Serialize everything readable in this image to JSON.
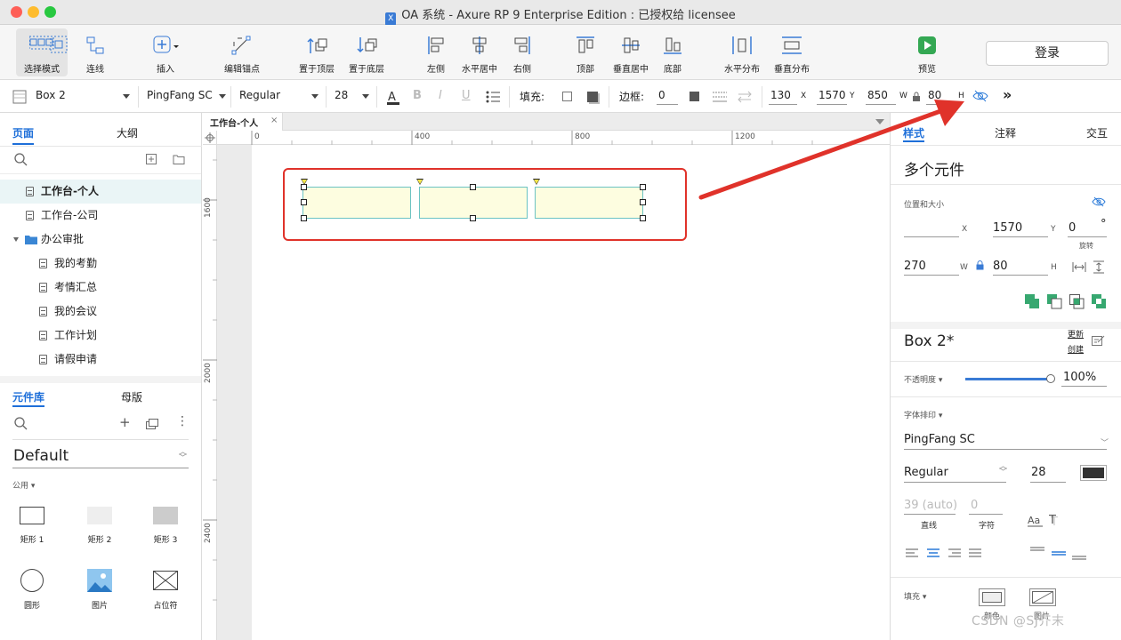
{
  "window": {
    "title": "OA 系统 - Axure RP 9 Enterprise Edition : 已授权给 licensee",
    "app_icon": "X"
  },
  "toolbar": {
    "items": [
      {
        "label": "选择模式"
      },
      {
        "label": "连线"
      },
      {
        "label": "插入"
      },
      {
        "label": "编辑锚点"
      },
      {
        "label": "置于顶层"
      },
      {
        "label": "置于底层"
      },
      {
        "label": "左侧"
      },
      {
        "label": "水平居中"
      },
      {
        "label": "右侧"
      },
      {
        "label": "顶部"
      },
      {
        "label": "垂直居中"
      },
      {
        "label": "底部"
      },
      {
        "label": "水平分布"
      },
      {
        "label": "垂直分布"
      },
      {
        "label": "预览"
      }
    ],
    "login_label": "登录"
  },
  "format": {
    "style_name": "Box 2",
    "font_family": "PingFang SC",
    "font_weight": "Regular",
    "font_size": "28",
    "fill_label": "填充:",
    "border_label": "边框:",
    "border_value": "0",
    "x": "130",
    "x_label": "X",
    "y": "1570",
    "y_label": "Y",
    "w": "850",
    "w_label": "W",
    "h": "80",
    "h_label": "H"
  },
  "left": {
    "tabs": {
      "pages": "页面",
      "outline": "大纲"
    },
    "pages": [
      {
        "label": "工作台-个人",
        "selected": true
      },
      {
        "label": "工作台-公司"
      }
    ],
    "folder": {
      "label": "办公审批"
    },
    "subpages": [
      {
        "label": "我的考勤"
      },
      {
        "label": "考情汇总"
      },
      {
        "label": "我的会议"
      },
      {
        "label": "工作计划"
      },
      {
        "label": "请假申请"
      }
    ],
    "libtabs": {
      "library": "元件库",
      "masters": "母版"
    },
    "library_name": "Default",
    "category": "公用",
    "widgets": [
      {
        "label": "矩形 1"
      },
      {
        "label": "矩形 2"
      },
      {
        "label": "矩形 3"
      },
      {
        "label": "圆形"
      },
      {
        "label": "图片"
      },
      {
        "label": "占位符"
      }
    ]
  },
  "canvas": {
    "doc_tab": "工作台-个人",
    "ruler_h": [
      "0",
      "400",
      "800",
      "1200"
    ],
    "ruler_v": [
      "1600",
      "2000",
      "2400"
    ]
  },
  "right": {
    "tabs": {
      "style": "样式",
      "notes": "注释",
      "interact": "交互"
    },
    "heading": "多个元件",
    "pos_size_label": "位置和大小",
    "x_label": "X",
    "y": "1570",
    "y_label": "Y",
    "rotation": "0",
    "rotation_unit": "°",
    "rotation_label": "旋转",
    "w": "270",
    "w_label": "W",
    "h": "80",
    "h_label": "H",
    "style_name": "Box 2*",
    "update_label": "更新",
    "create_label": "创建",
    "opacity_label": "不透明度",
    "opacity": "100%",
    "opacity_fraction": 1.0,
    "typography_label": "字体排印",
    "font_family": "PingFang SC",
    "font_weight": "Regular",
    "font_size": "28",
    "line_height": "39 (auto)",
    "line_label": "直线",
    "char_spacing": "0",
    "char_label": "字符",
    "fill_label": "填充",
    "fill_color_label": "颜色",
    "fill_image_label": "图片"
  },
  "watermark": "CSDN @SJ芥末",
  "colors": {
    "accent": "#1e6fd9",
    "annotation": "#e0322a",
    "box_fill": "#fdfde0",
    "box_border": "#6cc3c3"
  }
}
